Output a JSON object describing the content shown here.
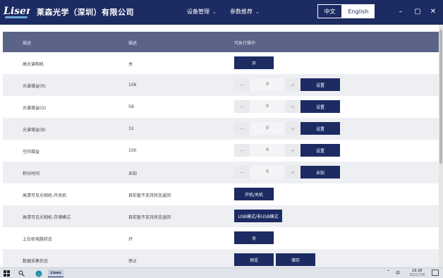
{
  "app": {
    "logo_text": "Lisen",
    "company_name": "莱森光学（深圳）有限公司"
  },
  "nav": {
    "device_mgmt": "设备管理",
    "param_settings": "参数推荐"
  },
  "lang": {
    "zh": "中文",
    "en": "English"
  },
  "window": {
    "minimize": "–",
    "restore": "▢",
    "close": "✕"
  },
  "table": {
    "headers": [
      "描述",
      "描述",
      "可执行操作"
    ],
    "rows": [
      {
        "name": "高光谱相机",
        "value": "关",
        "action_label": "开"
      },
      {
        "name": "光谱增益(R)",
        "value": "106",
        "stepper_value": "0",
        "minus": "−",
        "plus": "+",
        "action_label": "设置"
      },
      {
        "name": "光谱增益(G)",
        "value": "58",
        "stepper_value": "0",
        "minus": "−",
        "plus": "+",
        "action_label": "设置"
      },
      {
        "name": "光谱增益(B)",
        "value": "32",
        "stepper_value": "0",
        "minus": "−",
        "plus": "+",
        "action_label": "设置"
      },
      {
        "name": "空间增益",
        "value": "100",
        "stepper_value": "0",
        "minus": "−",
        "plus": "+",
        "action_label": "设置"
      },
      {
        "name": "积分时间",
        "value": "未知",
        "stepper_value": "0",
        "minus": "−",
        "plus": "+",
        "action_label": "未知"
      },
      {
        "name": "高清可见光相机-开关机",
        "value": "目前暂不支持状态返回",
        "action_label": "开机/关机"
      },
      {
        "name": "高清可见光相机-存储模式",
        "value": "目前暂不支持状态返回",
        "action_label": "USB模式/非USB模式"
      },
      {
        "name": "上位机电脑状态",
        "value": "开",
        "action_label": "关"
      },
      {
        "name": "数据采集状态",
        "value": "停止",
        "action_label": "预览",
        "action2_label": "储存"
      }
    ]
  },
  "taskbar": {
    "ime": "中",
    "time": "16:28",
    "date": "2021/7/6",
    "app_label": "Lisen"
  },
  "colors": {
    "primary": "#1d2b63",
    "header_bg": "#5b6389",
    "row_alt": "#eeeff3"
  }
}
